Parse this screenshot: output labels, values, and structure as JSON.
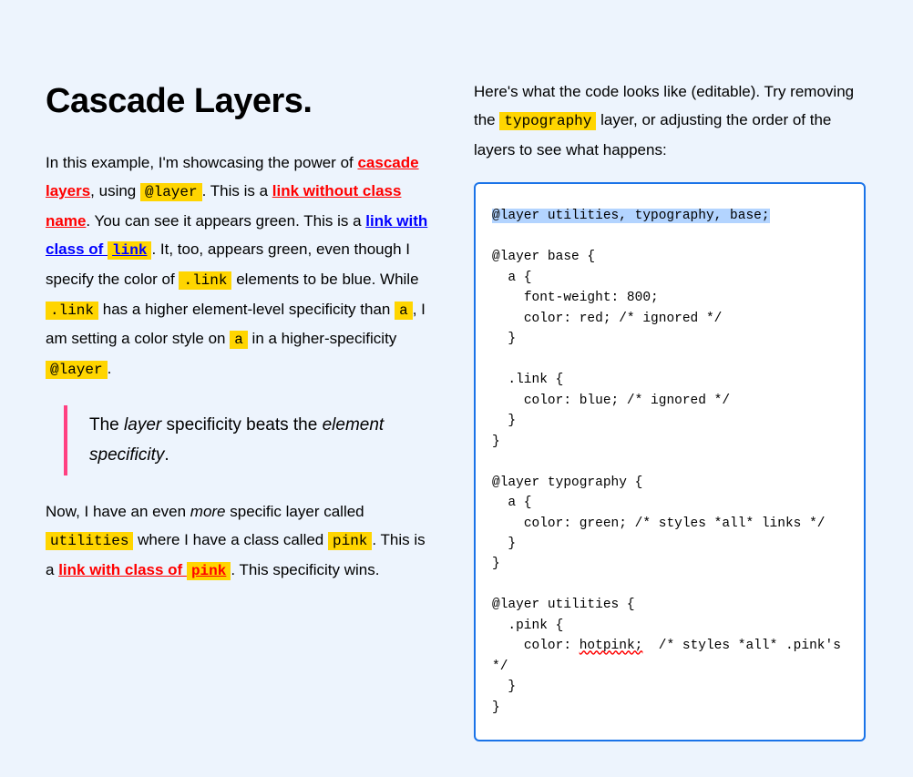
{
  "doc": {
    "heading": "Cascade Layers.",
    "p1_a": "In this example, I'm showcasing the power of ",
    "p1_link1": "cascade layers",
    "p1_b": ", using ",
    "p1_code1": "@layer",
    "p1_c": ". This is a ",
    "p1_link2": "link without class name",
    "p1_d": ". You can see it appears green. This is a ",
    "p1_link3_text": "link with class of ",
    "p1_link3_code": "link",
    "p1_e": ". It, too, appears green, even though I specify the color of ",
    "p1_code2": ".link",
    "p1_f": " elements to be blue. While ",
    "p1_code3": ".link",
    "p1_g": " has a higher element-level specificity than ",
    "p1_code4": "a",
    "p1_h": ", I am setting a color style on ",
    "p1_code5": "a",
    "p1_i": " in a higher-specificity ",
    "p1_code6": "@layer",
    "p1_j": ".",
    "quote_a": "The ",
    "quote_em1": "layer",
    "quote_b": " specificity beats the ",
    "quote_em2": "element specificity",
    "quote_c": ".",
    "p2_a": "Now, I have an even ",
    "p2_em": "more",
    "p2_b": " specific layer called ",
    "p2_code1": "utilities",
    "p2_c": " where I have a class called ",
    "p2_code2": "pink",
    "p2_d": ". This is a ",
    "p2_link_text": "link with class of ",
    "p2_link_code": "pink",
    "p2_e": ". This specificity wins.",
    "right_a": "Here's what the code looks like (editable). Try removing the ",
    "right_code": "typography",
    "right_b": " layer, or adjusting the order of the layers to see what happens:"
  },
  "editor": {
    "line_sel": "@layer utilities, typography, base;",
    "block1": "\n\n@layer base {\n  a {\n    font-weight: 800;\n    color: red; /* ignored */\n  }\n\n  .link {\n    color: blue; /* ignored */\n  }\n}\n\n@layer typography {\n  a {\n    color: green; /* styles *all* links */\n  }\n}\n\n@layer utilities {\n  .pink {\n    color: ",
    "squiggle": "hotpink;",
    "block2": "  /* styles *all* .pink's */\n  }\n}"
  }
}
